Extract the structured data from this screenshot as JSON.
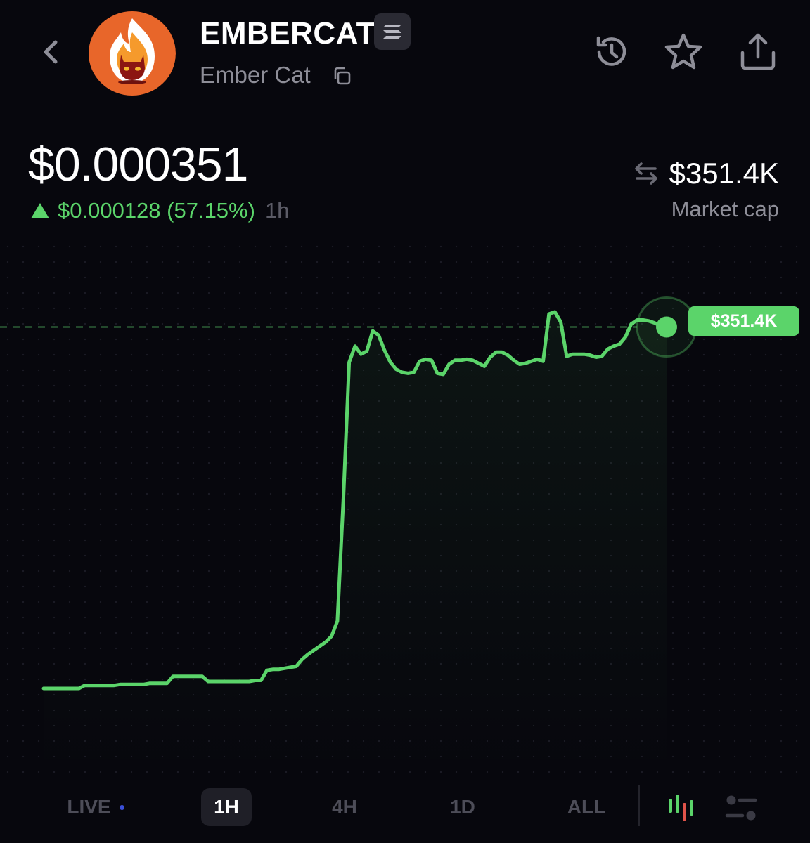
{
  "header": {
    "name": "EMBERCAT",
    "symbol": "Ember Cat",
    "icons": {
      "back": "chevron-left-icon",
      "chain": "solana-icon",
      "copy": "copy-icon",
      "history": "history-icon",
      "favorite": "star-icon",
      "share": "share-icon"
    }
  },
  "price": {
    "value": "$0.000351",
    "change": "$0.000128 (57.15%)",
    "period": "1h"
  },
  "market_cap": {
    "value": "$351.4K",
    "label": "Market cap"
  },
  "chart_data": {
    "type": "line",
    "series": [
      {
        "values": [
          58,
          58,
          58,
          58,
          58,
          58,
          58,
          61,
          61,
          61,
          61,
          61,
          61,
          62,
          62,
          62,
          62,
          62,
          63,
          63,
          63,
          63,
          70,
          70,
          70,
          70,
          70,
          70,
          65,
          65,
          65,
          65,
          65,
          65,
          65,
          65,
          66,
          66,
          76,
          77,
          77,
          78,
          79,
          80,
          87,
          92,
          96,
          100,
          104,
          110,
          125,
          245,
          382,
          398,
          390,
          393,
          413,
          409,
          394,
          382,
          375,
          372,
          371,
          372,
          383,
          385,
          384,
          371,
          370,
          380,
          384,
          384,
          385,
          384,
          381,
          378,
          387,
          392,
          392,
          389,
          384,
          380,
          381,
          383,
          385,
          383,
          430,
          432,
          422,
          388,
          390,
          390,
          390,
          389,
          387,
          388,
          395,
          398,
          400,
          407,
          420,
          424,
          424,
          423,
          421,
          418,
          417
        ],
        "color": "#5bd46a"
      }
    ],
    "current_value_label": "$351.4K",
    "dashed_reference_line": true,
    "grid": "dotted",
    "accent": "#5bd46a"
  },
  "timeframes": [
    {
      "label": "LIVE",
      "active": false
    },
    {
      "label": "1H",
      "active": true
    },
    {
      "label": "4H",
      "active": false
    },
    {
      "label": "1D",
      "active": false
    },
    {
      "label": "ALL",
      "active": false
    }
  ],
  "bottom_icons": [
    "candlestick-chart-icon",
    "settings-sliders-icon"
  ]
}
